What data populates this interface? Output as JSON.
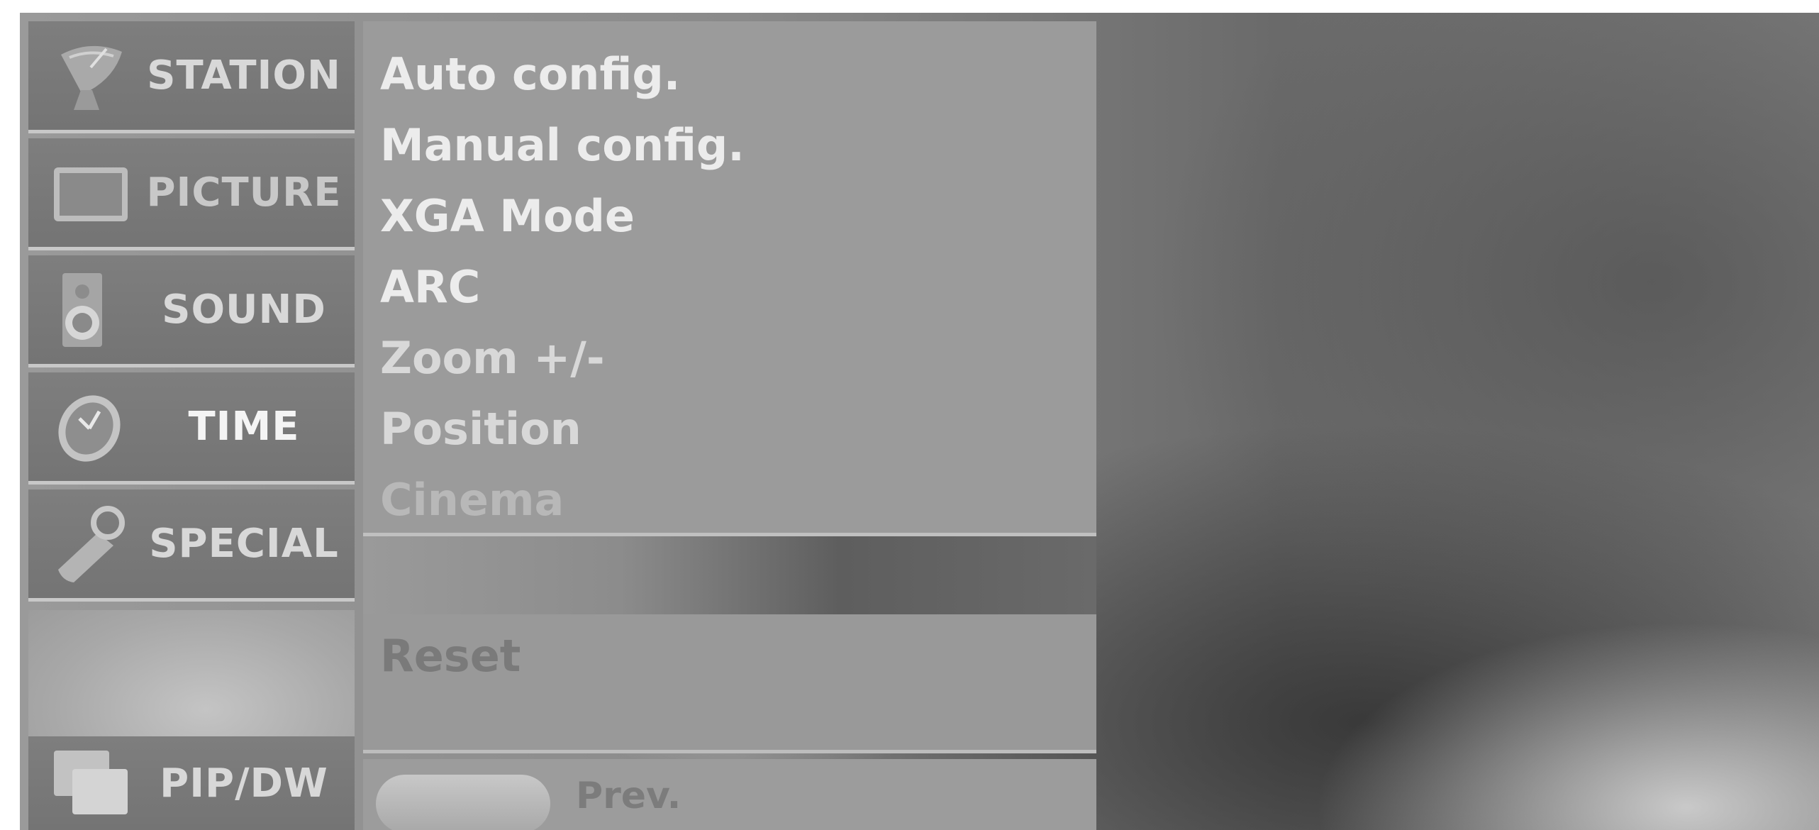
{
  "sidebar": {
    "items": [
      {
        "label": "STATION",
        "icon": "satellite-dish-icon"
      },
      {
        "label": "PICTURE",
        "icon": "tv-screen-icon"
      },
      {
        "label": "SOUND",
        "icon": "speaker-icon"
      },
      {
        "label": "TIME",
        "icon": "clock-icon"
      },
      {
        "label": "SPECIAL",
        "icon": "key-tag-icon"
      },
      {
        "label": "PIP/DW",
        "icon": "pip-windows-icon"
      }
    ]
  },
  "menu": {
    "items": [
      {
        "label": "Auto config."
      },
      {
        "label": "Manual config."
      },
      {
        "label": "XGA Mode"
      },
      {
        "label": "ARC"
      },
      {
        "label": "Zoom +/-"
      },
      {
        "label": "Position"
      },
      {
        "label": "Cinema"
      }
    ],
    "reset_label": "Reset",
    "prev_label": "Prev."
  },
  "colors": {
    "panel": "#9b9b9b",
    "sidebar": "#7a7a7a",
    "text_bright": "#ececec",
    "text_dim": "#7a7a7a"
  }
}
